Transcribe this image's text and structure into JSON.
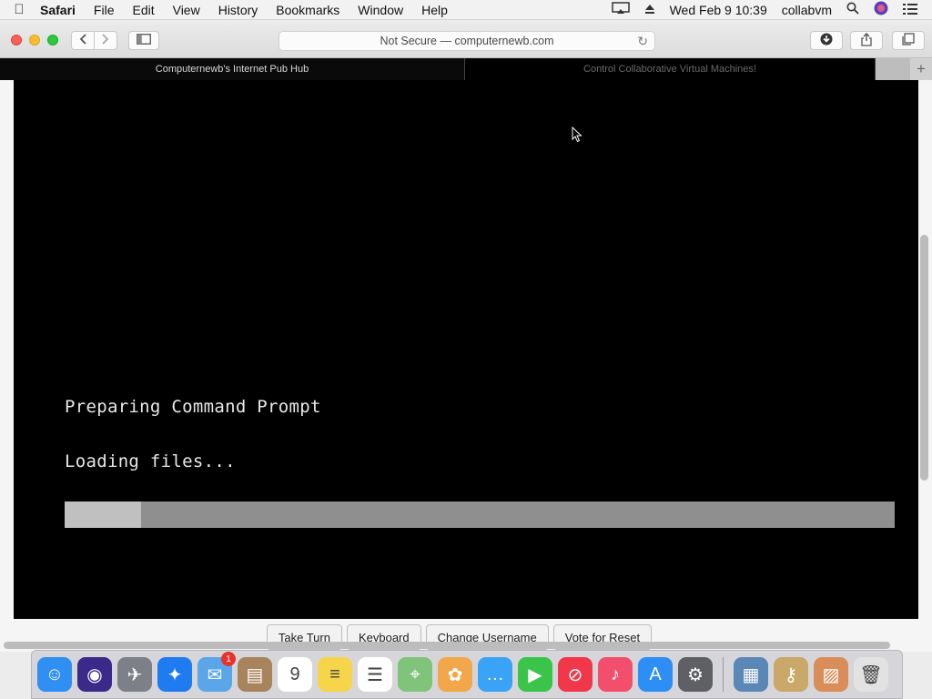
{
  "menubar": {
    "app_name": "Safari",
    "menus": [
      "File",
      "Edit",
      "View",
      "History",
      "Bookmarks",
      "Window",
      "Help"
    ],
    "datetime": "Wed Feb 9  10:39",
    "username": "collabvm"
  },
  "toolbar": {
    "address": "Not Secure — computernewb.com"
  },
  "tabs": [
    {
      "label": "Computernewb's Internet Pub Hub",
      "active": true
    },
    {
      "label": "Control Collaborative Virtual Machines!",
      "active": false
    }
  ],
  "vm": {
    "line1": "Preparing Command Prompt",
    "line2": "Loading files...",
    "progress": 0.092
  },
  "vm_controls": [
    "Take Turn",
    "Keyboard",
    "Change Username",
    "Vote for Reset"
  ],
  "dock": {
    "apps": [
      {
        "name": "Finder",
        "color": "#2f8ff3",
        "glyph": "☺"
      },
      {
        "name": "Siri",
        "color": "#3b2a8a",
        "glyph": "◉"
      },
      {
        "name": "Launchpad",
        "color": "#7d8087",
        "glyph": "✈"
      },
      {
        "name": "Safari",
        "color": "#1f7bf0",
        "glyph": "✦"
      },
      {
        "name": "Mail",
        "color": "#5aa6e8",
        "glyph": "✉",
        "badge": "1"
      },
      {
        "name": "Contacts",
        "color": "#a7845c",
        "glyph": "▤"
      },
      {
        "name": "Calendar",
        "color": "#ffffff",
        "glyph": "9"
      },
      {
        "name": "Notes",
        "color": "#f6d54a",
        "glyph": "≡"
      },
      {
        "name": "Reminders",
        "color": "#ffffff",
        "glyph": "☰"
      },
      {
        "name": "Maps",
        "color": "#7fc47a",
        "glyph": "⌖"
      },
      {
        "name": "Photos",
        "color": "#f2a74b",
        "glyph": "✿"
      },
      {
        "name": "Messages",
        "color": "#3aa3f5",
        "glyph": "…"
      },
      {
        "name": "FaceTime",
        "color": "#3bc44a",
        "glyph": "▶"
      },
      {
        "name": "News",
        "color": "#f0384a",
        "glyph": "⊘"
      },
      {
        "name": "Music",
        "color": "#f34f6c",
        "glyph": "♪"
      },
      {
        "name": "App Store",
        "color": "#2d8ef5",
        "glyph": "A"
      },
      {
        "name": "System Preferences",
        "color": "#5e6064",
        "glyph": "⚙"
      }
    ],
    "others": [
      {
        "name": "Preview",
        "color": "#5a87b5",
        "glyph": "▦"
      },
      {
        "name": "Keychain Access",
        "color": "#c9a86a",
        "glyph": "⚷"
      },
      {
        "name": "Downloads Stack",
        "color": "#d98e5a",
        "glyph": "▨"
      },
      {
        "name": "Trash",
        "color": "#e2e2e2",
        "glyph": "🗑"
      }
    ]
  }
}
